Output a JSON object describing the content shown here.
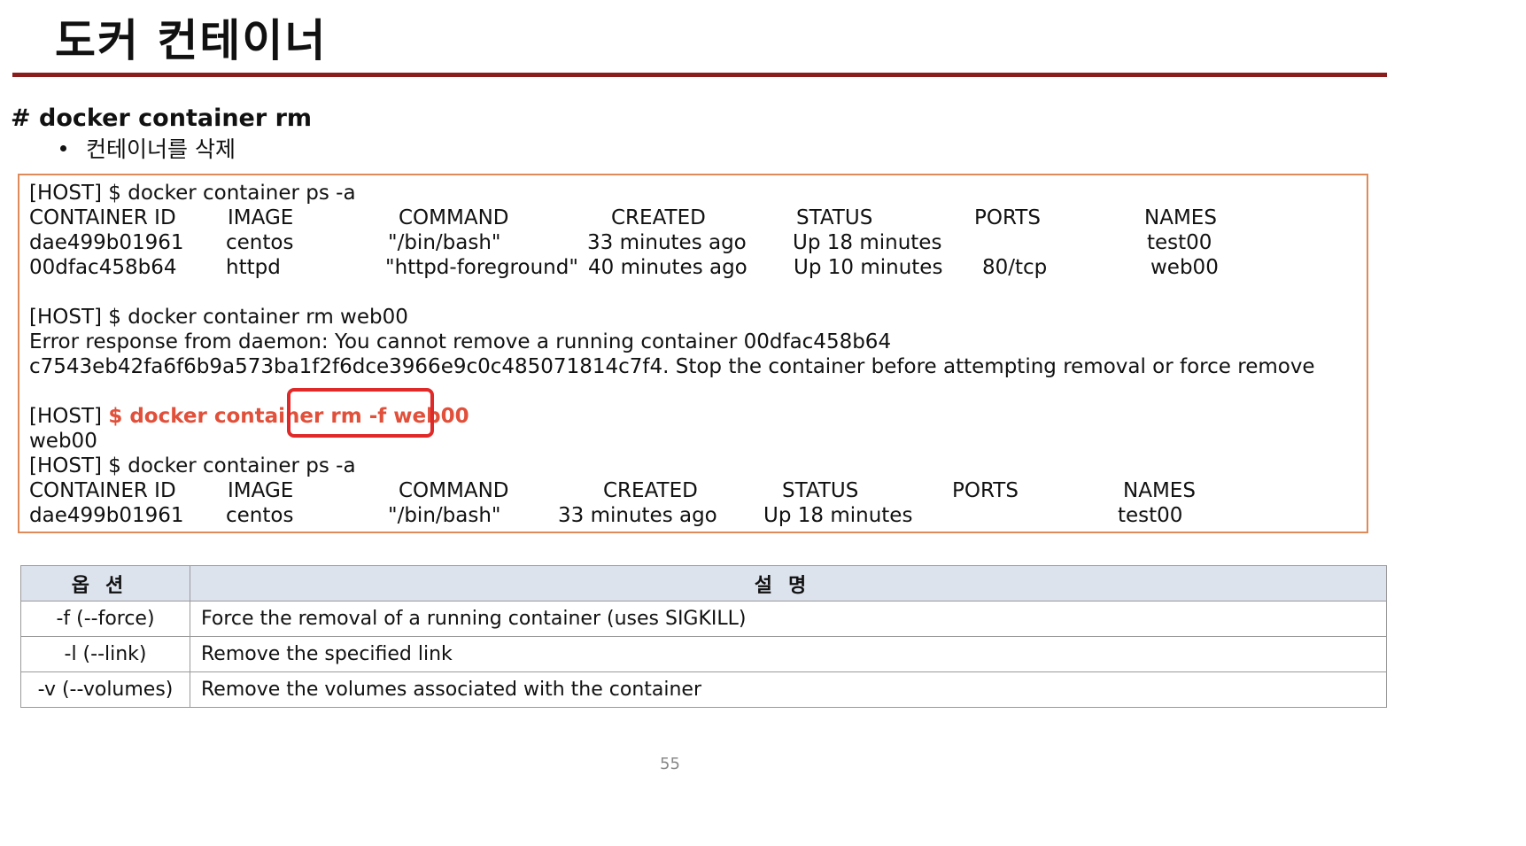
{
  "title": "도커 컨테이너",
  "heading": "# docker container rm",
  "bullet": "컨테이너를 삭제",
  "code": {
    "block1": {
      "cmd": "[HOST] $ docker container ps -a",
      "header": [
        "CONTAINER ID",
        "IMAGE",
        "COMMAND",
        "CREATED",
        "STATUS",
        "PORTS",
        "NAMES"
      ],
      "rows": [
        [
          "dae499b01961",
          "centos",
          "\"/bin/bash\"",
          "33 minutes ago",
          "Up 18 minutes",
          "",
          "test00"
        ],
        [
          "00dfac458b64",
          "httpd",
          "\"httpd-foreground\"",
          "40 minutes ago",
          "Up 10 minutes",
          "80/tcp",
          "web00"
        ]
      ]
    },
    "block2": {
      "cmd": "[HOST] $ docker container rm web00",
      "error1": "Error response from daemon: You cannot remove a running container 00dfac458b64",
      "error2": "c7543eb42fa6f6b9a573ba1f2f6dce3966e9c0c485071814c7f4. Stop the container before attempting removal or force remove"
    },
    "block3": {
      "prefix": "[HOST] ",
      "cmd_highlight": "$ docker container rm -f web00",
      "output": "web00"
    },
    "block4": {
      "cmd": "[HOST] $ docker container ps -a",
      "header": [
        "CONTAINER ID",
        "IMAGE",
        "COMMAND",
        "CREATED",
        "STATUS",
        "PORTS",
        "NAMES"
      ],
      "rows": [
        [
          "dae499b01961",
          "centos",
          "\"/bin/bash\"",
          "33 minutes ago",
          "Up 18 minutes",
          "",
          "test00"
        ]
      ]
    }
  },
  "options_table": {
    "headers": [
      "옵션",
      "설명"
    ],
    "rows": [
      [
        "-f (--force)",
        "Force the removal of a running container (uses SIGKILL)"
      ],
      [
        "-l (--link)",
        "Remove the specified link"
      ],
      [
        "-v (--volumes)",
        "Remove the volumes associated with the container"
      ]
    ]
  },
  "page_number": "55",
  "colors": {
    "title_rule": "#8b1c1c",
    "highlight": "#e0503a",
    "callout": "#e02a2a",
    "box_border": "#e08a5a",
    "table_header": "#dde3ed"
  }
}
